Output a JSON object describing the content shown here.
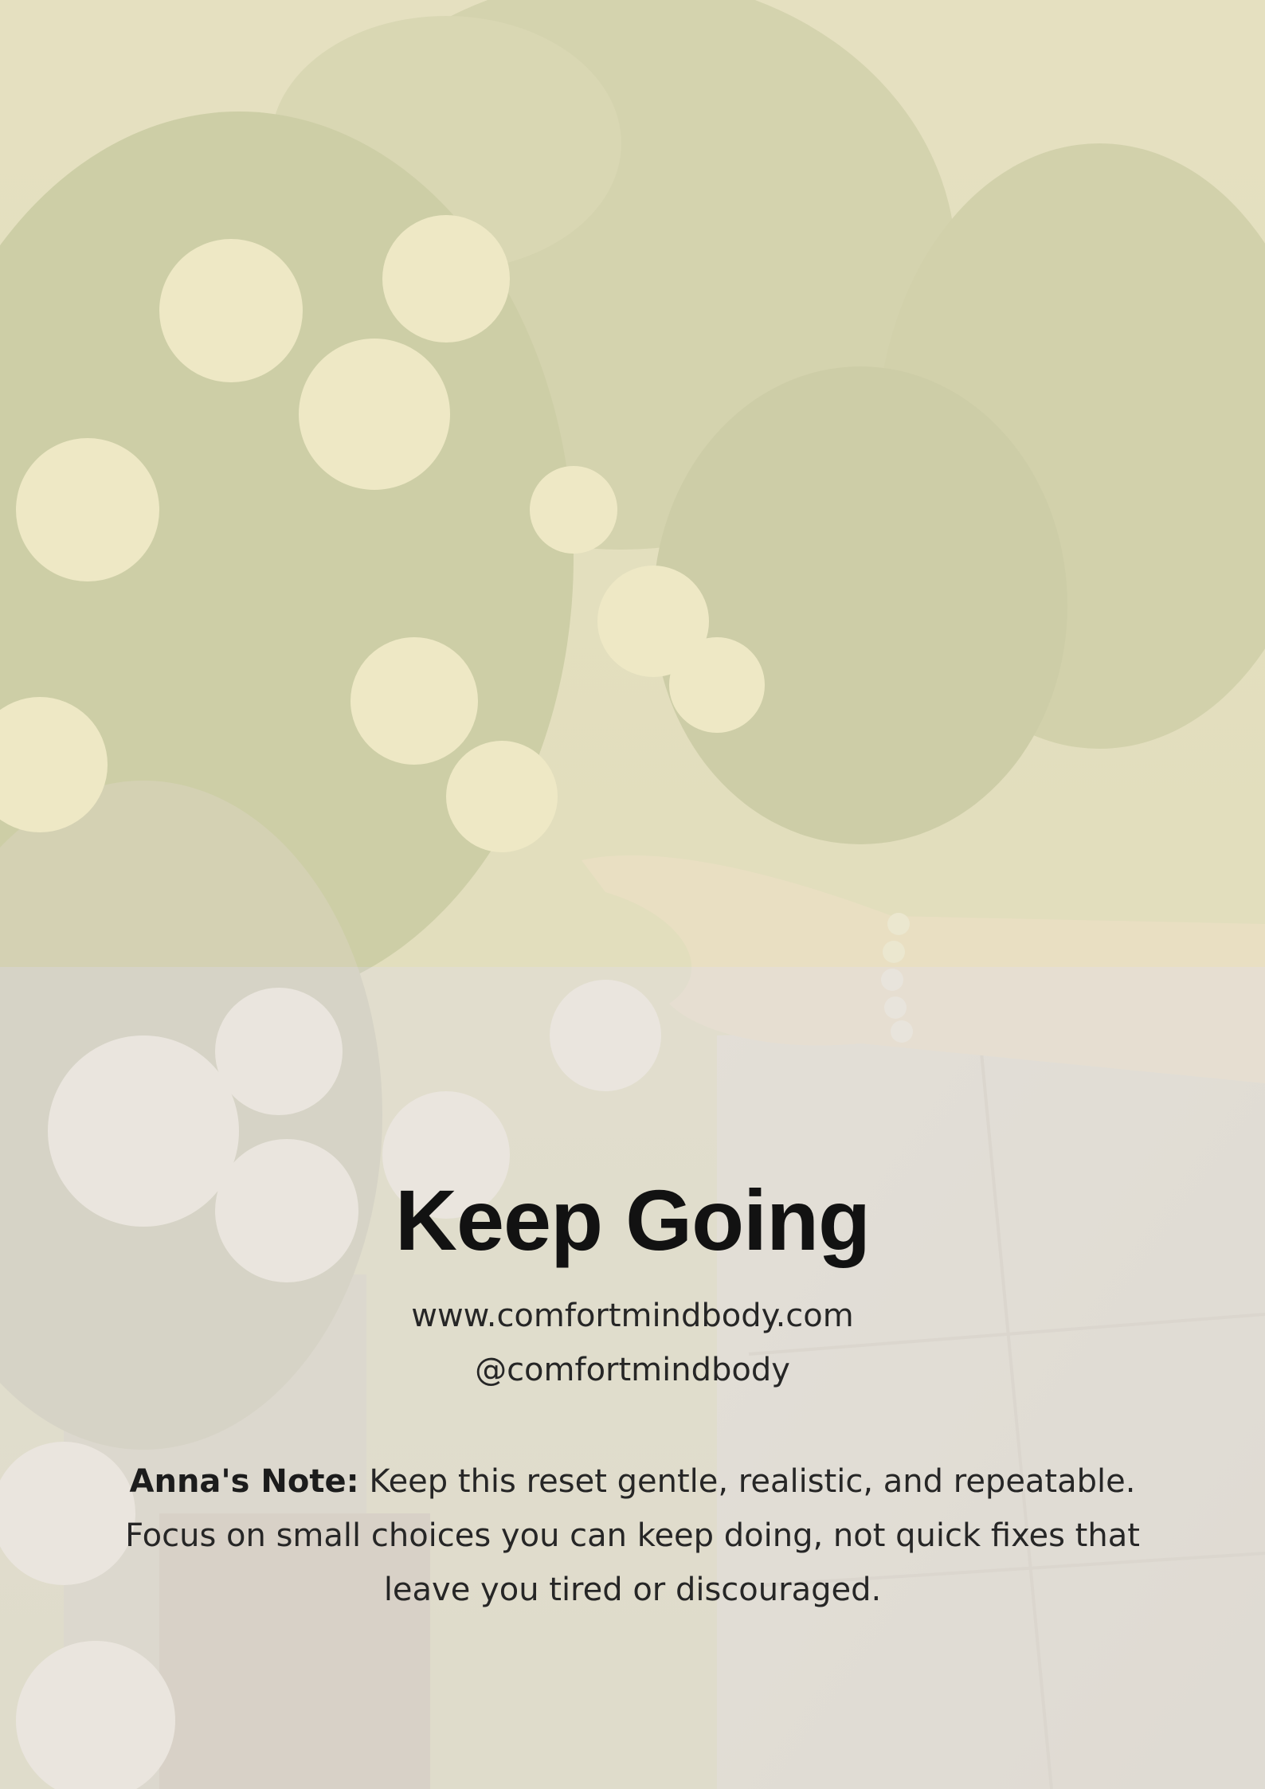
{
  "title": "Keep Going",
  "website": "www.comfortmindbody.com",
  "handle": "@comfortmindbody",
  "note": {
    "label": "Anna's Note:",
    "text": "Keep this reset gentle, realistic, and repeatable. Focus on small choices you can keep doing, not quick fixes that leave you tired or discouraged."
  },
  "colors": {
    "upper_wash": "#eee8c4",
    "lower_wash": "#e8e4dc",
    "text": "#1f1f1f"
  }
}
